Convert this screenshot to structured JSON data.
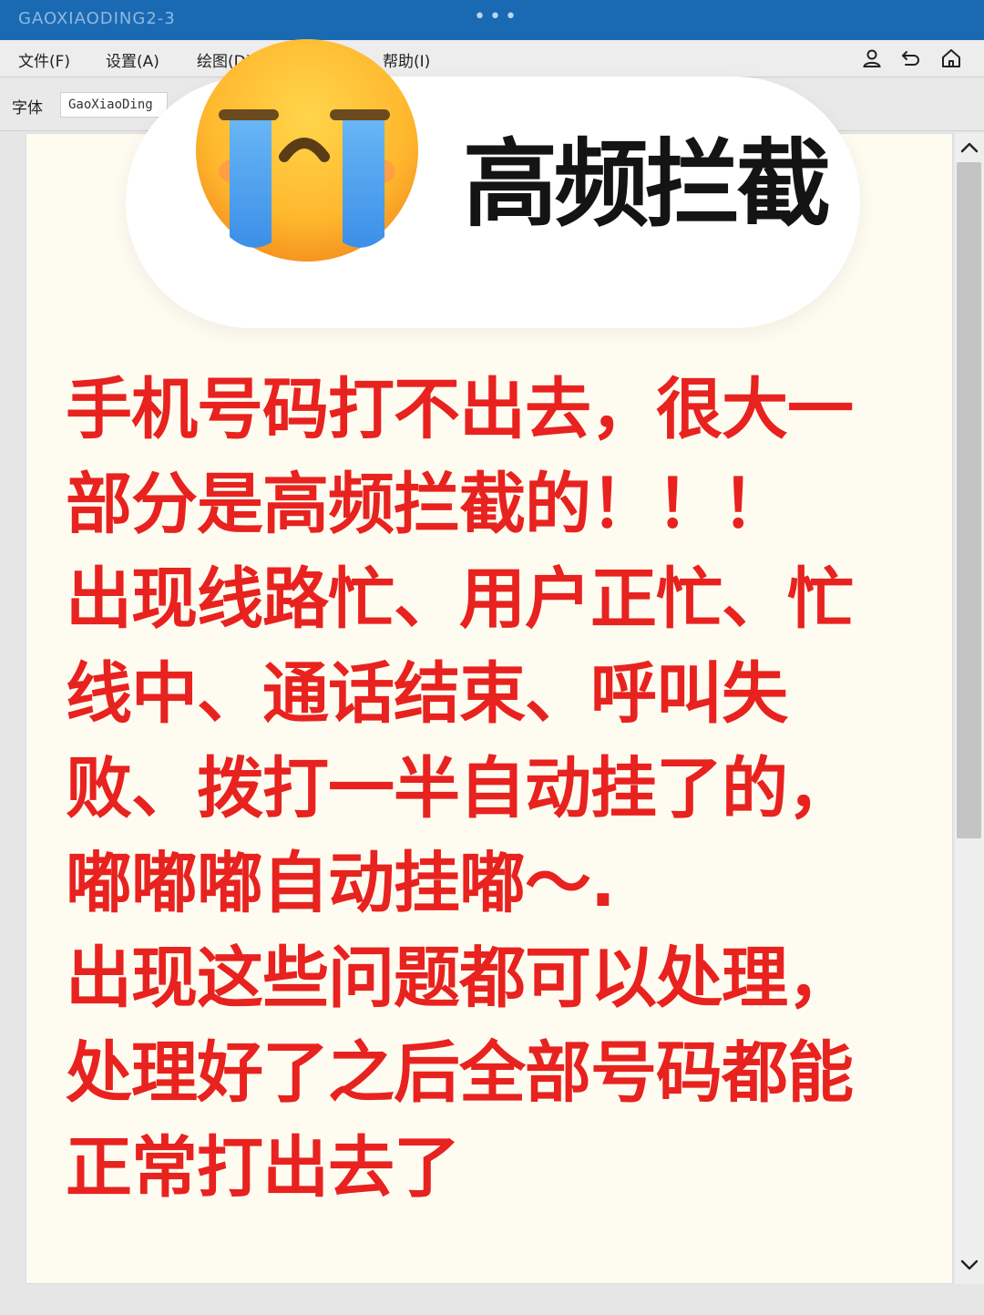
{
  "window": {
    "title": "GAOXIAODING2-3",
    "dots": "•••"
  },
  "menu": {
    "file": "文件(F)",
    "settings": "设置(A)",
    "draw": "绘图(D)",
    "help": "帮助(I)"
  },
  "toolbar": {
    "font_label": "字体",
    "font_value": "GaoXiaoDing"
  },
  "icons": [
    "user-icon",
    "undo-icon",
    "home-icon",
    "crying-face-emoji",
    "chevron-up-icon",
    "chevron-down-icon"
  ],
  "bubble": {
    "title": "高频拦截"
  },
  "body": {
    "lines": [
      "手机号码打不出去，很大一",
      "部分是高频拦截的！！！",
      "出现线路忙、用户正忙、忙",
      "线中、通话结束、呼叫失",
      "败、拨打一半自动挂了的，",
      "嘟嘟嘟自动挂嘟～.",
      "出现这些问题都可以处理，",
      "处理好了之后全部号码都能",
      "正常打出去了"
    ]
  },
  "colors": {
    "titlebar": "#1a6ab3",
    "body_text": "#e8221f",
    "document_bg": "#fefcf1"
  }
}
